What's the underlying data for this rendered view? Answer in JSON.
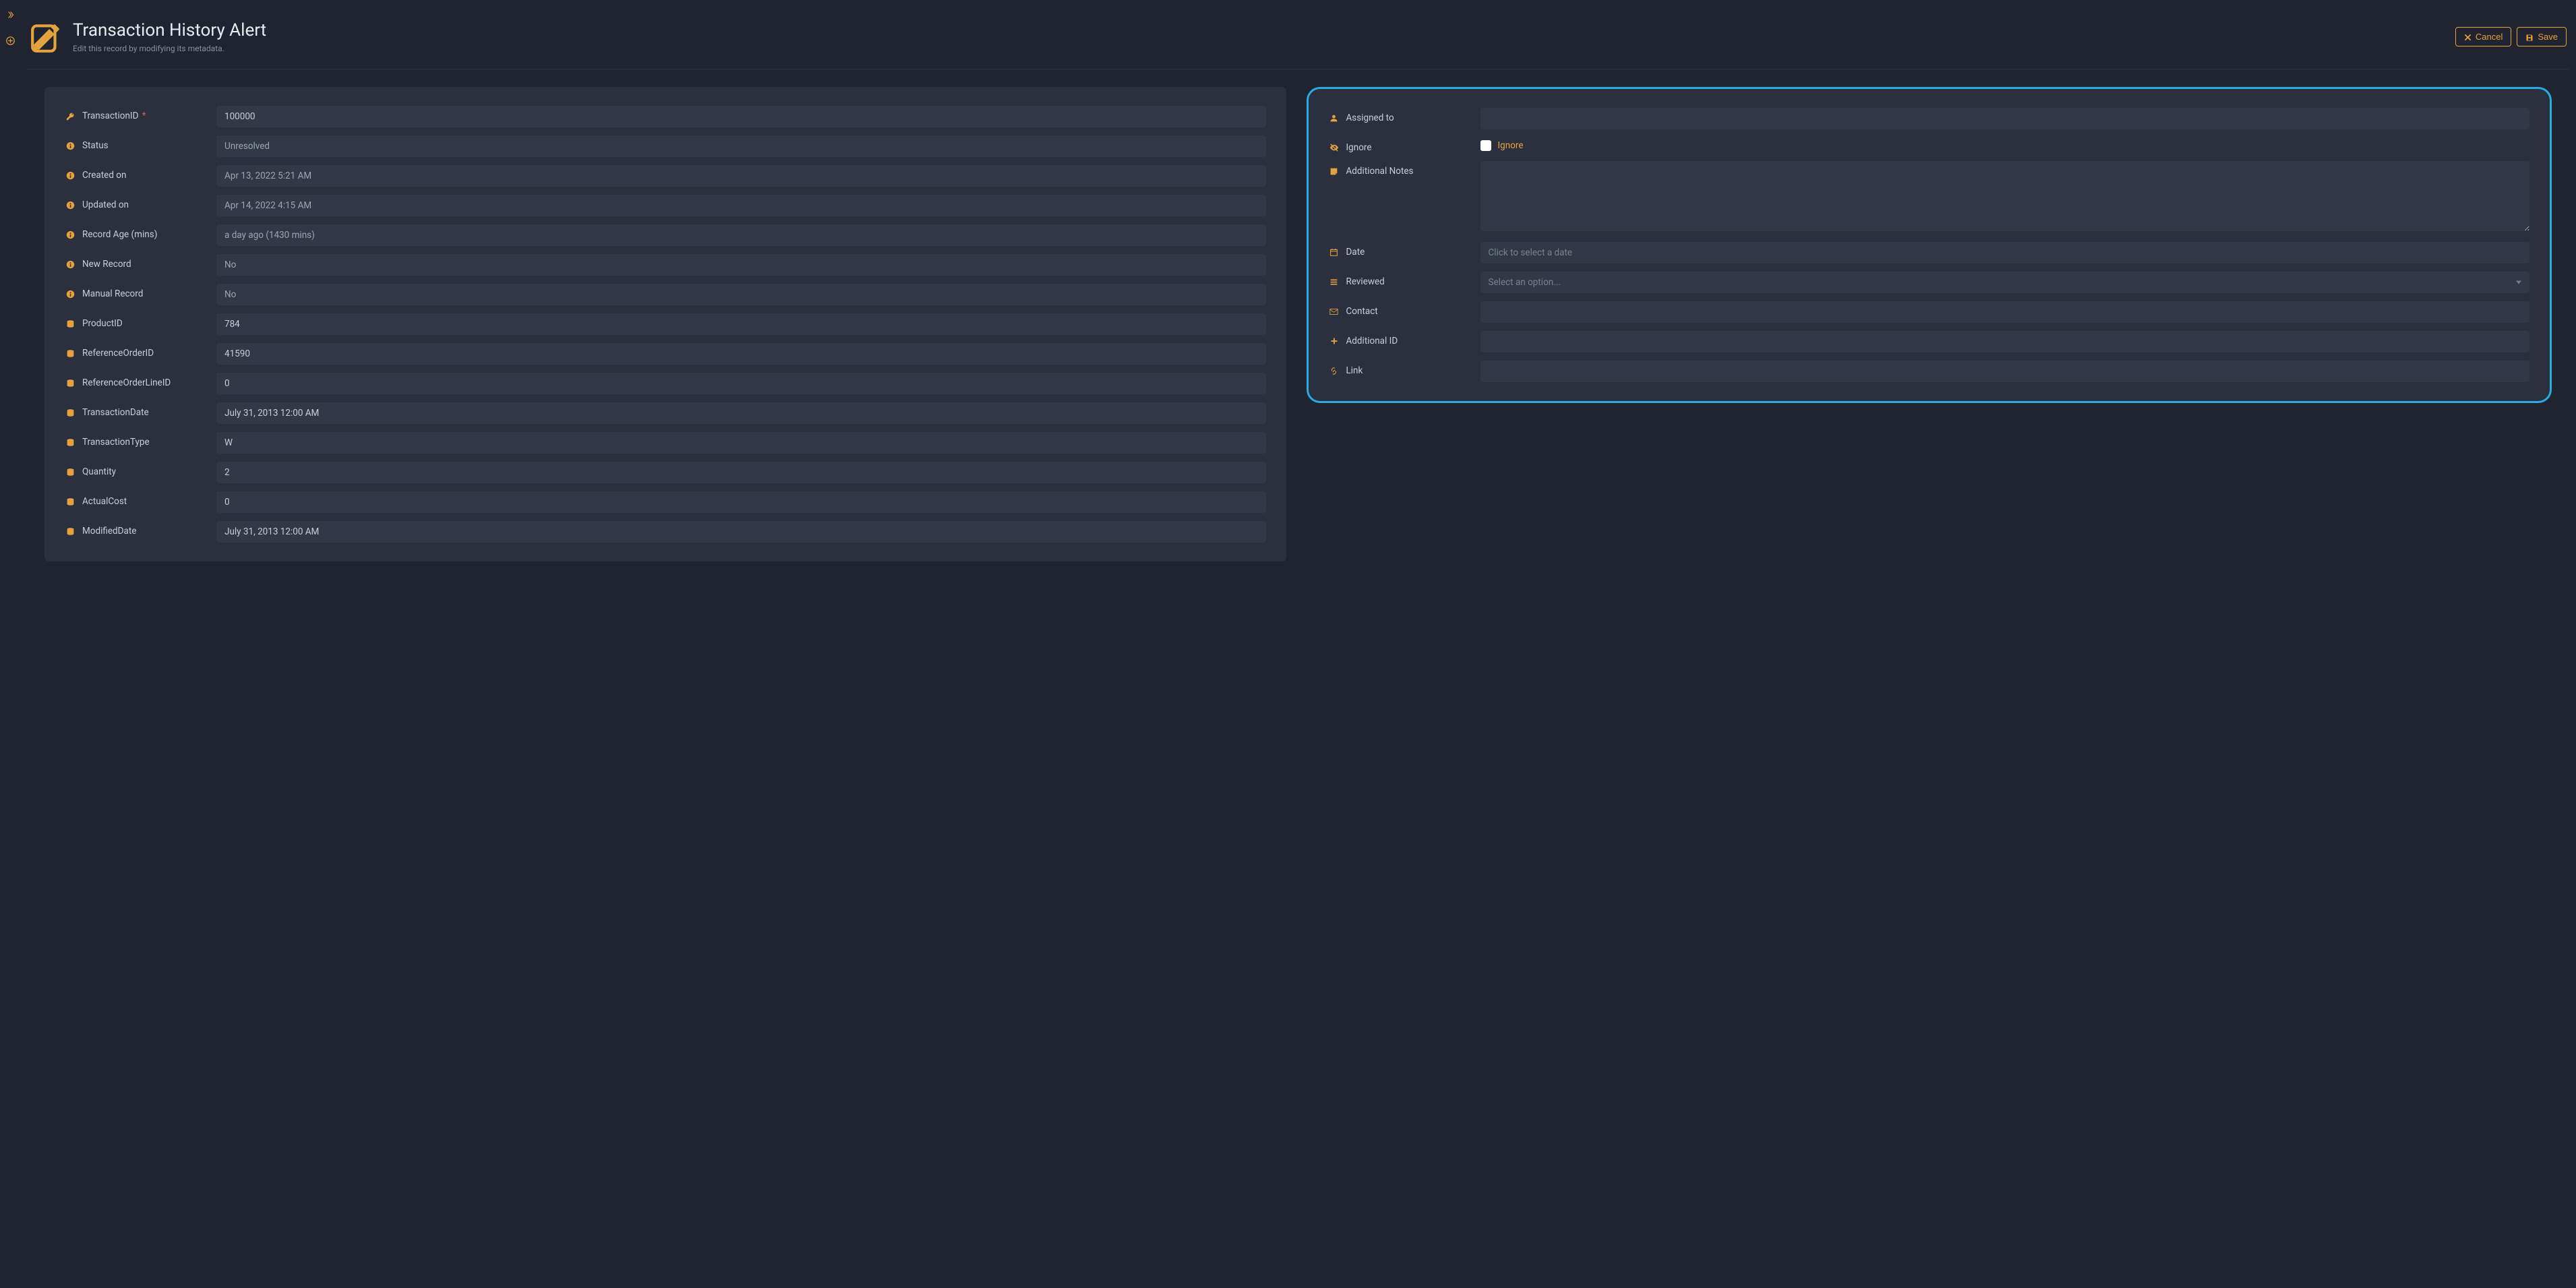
{
  "header": {
    "title": "Transaction History Alert",
    "subtitle": "Edit this record by modifying its metadata.",
    "cancel_label": "Cancel",
    "save_label": "Save"
  },
  "left_fields": [
    {
      "icon": "key",
      "label": "TransactionID",
      "value": "100000",
      "required": true,
      "readonly": false
    },
    {
      "icon": "info",
      "label": "Status",
      "value": "Unresolved",
      "required": false,
      "readonly": true
    },
    {
      "icon": "info",
      "label": "Created on",
      "value": "Apr 13, 2022 5:21 AM",
      "required": false,
      "readonly": true
    },
    {
      "icon": "info",
      "label": "Updated on",
      "value": "Apr 14, 2022 4:15 AM",
      "required": false,
      "readonly": true
    },
    {
      "icon": "info",
      "label": "Record Age (mins)",
      "value": "a day ago (1430 mins)",
      "required": false,
      "readonly": true
    },
    {
      "icon": "info",
      "label": "New Record",
      "value": "No",
      "required": false,
      "readonly": true
    },
    {
      "icon": "info",
      "label": "Manual Record",
      "value": "No",
      "required": false,
      "readonly": true
    },
    {
      "icon": "db",
      "label": "ProductID",
      "value": "784",
      "required": false,
      "readonly": false
    },
    {
      "icon": "db",
      "label": "ReferenceOrderID",
      "value": "41590",
      "required": false,
      "readonly": false
    },
    {
      "icon": "db",
      "label": "ReferenceOrderLineID",
      "value": "0",
      "required": false,
      "readonly": false
    },
    {
      "icon": "db",
      "label": "TransactionDate",
      "value": "July 31, 2013 12:00 AM",
      "required": false,
      "readonly": false
    },
    {
      "icon": "db",
      "label": "TransactionType",
      "value": "W",
      "required": false,
      "readonly": false
    },
    {
      "icon": "db",
      "label": "Quantity",
      "value": "2",
      "required": false,
      "readonly": false
    },
    {
      "icon": "db",
      "label": "ActualCost",
      "value": "0",
      "required": false,
      "readonly": false
    },
    {
      "icon": "db",
      "label": "ModifiedDate",
      "value": "July 31, 2013 12:00 AM",
      "required": false,
      "readonly": false
    }
  ],
  "right": {
    "assigned_to": {
      "label": "Assigned to",
      "value": ""
    },
    "ignore": {
      "label": "Ignore",
      "checkbox_label": "Ignore",
      "checked": false
    },
    "notes": {
      "label": "Additional Notes",
      "value": ""
    },
    "date": {
      "label": "Date",
      "placeholder": "Click to select a date",
      "value": ""
    },
    "reviewed": {
      "label": "Reviewed",
      "placeholder": "Select an option..."
    },
    "contact": {
      "label": "Contact",
      "value": ""
    },
    "additional_id": {
      "label": "Additional ID",
      "value": ""
    },
    "link": {
      "label": "Link",
      "value": ""
    }
  }
}
